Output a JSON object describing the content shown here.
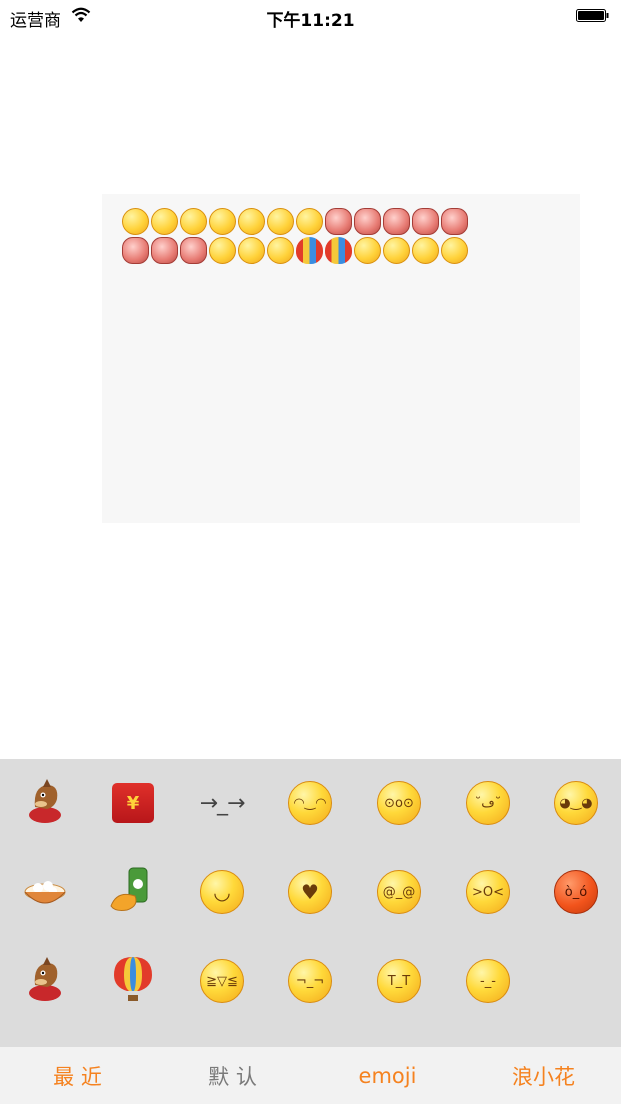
{
  "status_bar": {
    "carrier": "运营商",
    "time": "下午11:21",
    "wifi_icon": "wifi-icon",
    "battery_icon": "battery-icon"
  },
  "text_area": {
    "inserted_emoticons": [
      [
        "smile",
        "grin",
        "shush",
        "shush",
        "pensive",
        "pensive",
        "pensive",
        "sticker",
        "sticker",
        "sticker",
        "sticker",
        "sticker"
      ],
      [
        "sticker",
        "sticker",
        "sticker",
        "grin",
        "grin",
        "grin",
        "balloon",
        "balloon",
        "pensive",
        "pensive",
        "pensive",
        "pensive"
      ]
    ]
  },
  "keyboard": {
    "rows": [
      [
        {
          "icon": "horse-icon"
        },
        {
          "icon": "red-envelope-icon",
          "glyph": "¥"
        },
        {
          "kaomoji": "→_→"
        },
        {
          "icon": "laugh-icon",
          "glyph": "◠‿◠"
        },
        {
          "icon": "surprised-sweat-icon",
          "glyph": "⊙o⊙"
        },
        {
          "icon": "tongue-icon",
          "glyph": "˘ڡ˘"
        },
        {
          "icon": "blush-icon",
          "glyph": "◕‿◕"
        }
      ],
      [
        {
          "icon": "dumplings-bowl-icon"
        },
        {
          "icon": "beer-chicken-icon"
        },
        {
          "icon": "smile-icon",
          "glyph": "◡"
        },
        {
          "icon": "heart-love-icon",
          "glyph": "♥"
        },
        {
          "icon": "dizzy-icon",
          "glyph": "@_@"
        },
        {
          "icon": "yawn-icon",
          "glyph": ">O<"
        },
        {
          "icon": "angry-icon",
          "glyph": "ò_ó"
        }
      ],
      [
        {
          "icon": "rocking-horse-icon"
        },
        {
          "icon": "balloon-icon"
        },
        {
          "icon": "grin-icon",
          "glyph": "≧▽≦"
        },
        {
          "icon": "shush-icon",
          "glyph": "¬_¬"
        },
        {
          "icon": "crying-icon",
          "glyph": "T_T"
        },
        {
          "icon": "annoyed-icon",
          "glyph": "-_-"
        }
      ]
    ]
  },
  "tabs": [
    {
      "label": "最 近",
      "color": "#f5821f"
    },
    {
      "label": "默 认",
      "color": "#7a7a7a"
    },
    {
      "label": "emoji",
      "color": "#f5821f"
    },
    {
      "label": "浪小花",
      "color": "#f5821f"
    }
  ],
  "colors": {
    "accent": "#f5821f",
    "keyboard_bg": "#dcdcdc",
    "tab_bar_bg": "#f2f2f2",
    "text_area_bg": "#f7f7f7"
  }
}
